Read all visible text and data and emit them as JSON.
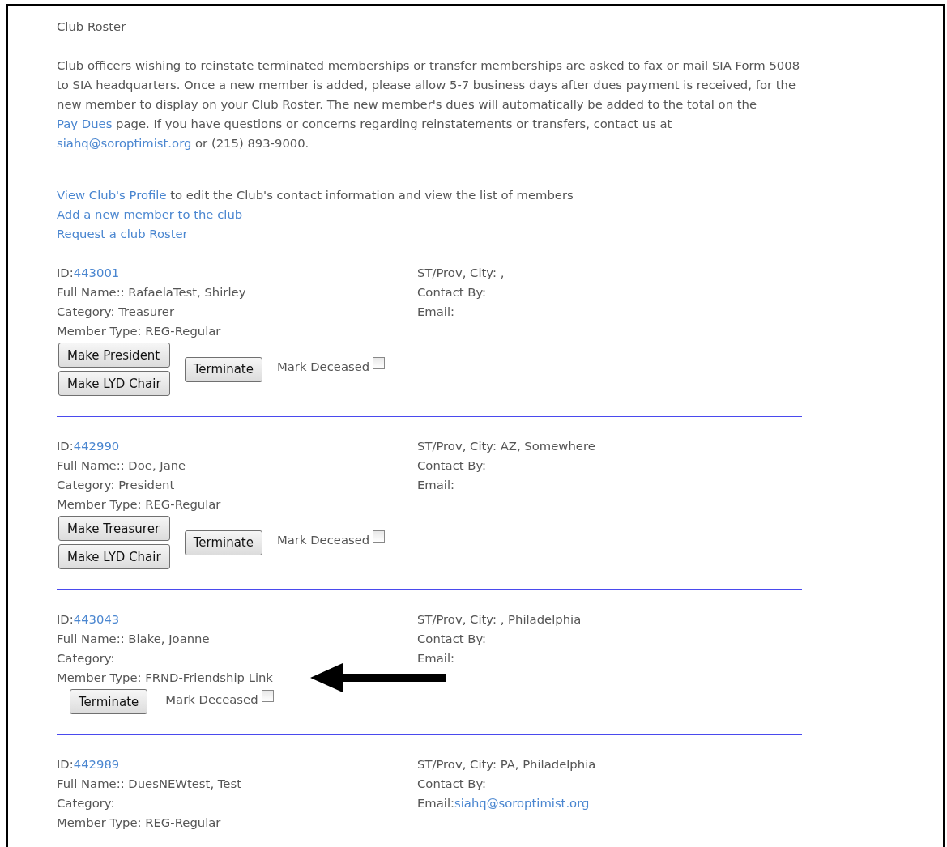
{
  "title": "Club Roster",
  "intro": [
    {
      "kind": "text",
      "text": "Club officers wishing to reinstate terminated memberships or transfer memberships are asked to fax or mail SIA Form 5008 to SIA headquarters. Once a new member is added, please allow 5-7 business days after dues payment is received, for the new member to display on your Club Roster. The new member's dues will automatically be added to the total on the "
    },
    {
      "kind": "link",
      "text": "Pay Dues"
    },
    {
      "kind": "text",
      "text": " page. If you have questions or concerns regarding reinstatements or transfers, contact us at "
    },
    {
      "kind": "link",
      "text": "siahq@soroptimist.org"
    },
    {
      "kind": "text",
      "text": " or (215) 893-9000."
    }
  ],
  "actions": [
    {
      "link": "View Club's Profile",
      "text": " to edit the Club's contact information and view the list of members"
    },
    {
      "link": "Add a new member to the club"
    },
    {
      "link": "Request a club Roster"
    }
  ],
  "members": [
    {
      "left": [
        {
          "text": "ID:",
          "link": "443001"
        },
        {
          "text": "Full Name:: RafaelaTest, Shirley"
        },
        {
          "text": "Category: Treasurer"
        },
        {
          "text": "Member Type: REG-Regular"
        }
      ],
      "right": [
        {
          "text": "ST/Prov, City: ,"
        },
        {
          "text": "Contact By:"
        },
        {
          "text": "Email:"
        }
      ],
      "role_buttons": [
        "Make President",
        "Make LYD Chair"
      ],
      "terminate": "Terminate",
      "deceased_label": "Mark Deceased",
      "deceased": false,
      "pointer_arrow": false
    },
    {
      "left": [
        {
          "text": "ID:",
          "link": "442990"
        },
        {
          "text": "Full Name:: Doe, Jane"
        },
        {
          "text": "Category: President"
        },
        {
          "text": "Member Type: REG-Regular"
        }
      ],
      "right": [
        {
          "text": "ST/Prov, City: AZ, Somewhere"
        },
        {
          "text": "Contact By:"
        },
        {
          "text": "Email:"
        }
      ],
      "role_buttons": [
        "Make Treasurer",
        "Make LYD Chair"
      ],
      "terminate": "Terminate",
      "deceased_label": "Mark Deceased",
      "deceased": false,
      "pointer_arrow": false
    },
    {
      "left": [
        {
          "text": "ID:",
          "link": "443043"
        },
        {
          "text": "Full Name:: Blake, Joanne"
        },
        {
          "text": "Category:"
        },
        {
          "text": "Member Type: FRND-Friendship Link"
        }
      ],
      "right": [
        {
          "text": "ST/Prov, City: , Philadelphia"
        },
        {
          "text": "Contact By:"
        },
        {
          "text": "Email:"
        }
      ],
      "terminate": "Terminate",
      "deceased_label": "Mark Deceased",
      "deceased": false,
      "pointer_arrow": true
    },
    {
      "left": [
        {
          "text": "ID:",
          "link": "442989"
        },
        {
          "text": "Full Name:: DuesNEWtest, Test"
        },
        {
          "text": "Category:"
        },
        {
          "text": "Member Type: REG-Regular"
        }
      ],
      "right": [
        {
          "text": "ST/Prov, City: PA, Philadelphia"
        },
        {
          "text": "Contact By:"
        },
        {
          "text": "Email:",
          "link": "siahq@soroptimist.org"
        }
      ],
      "pointer_arrow": false
    }
  ]
}
